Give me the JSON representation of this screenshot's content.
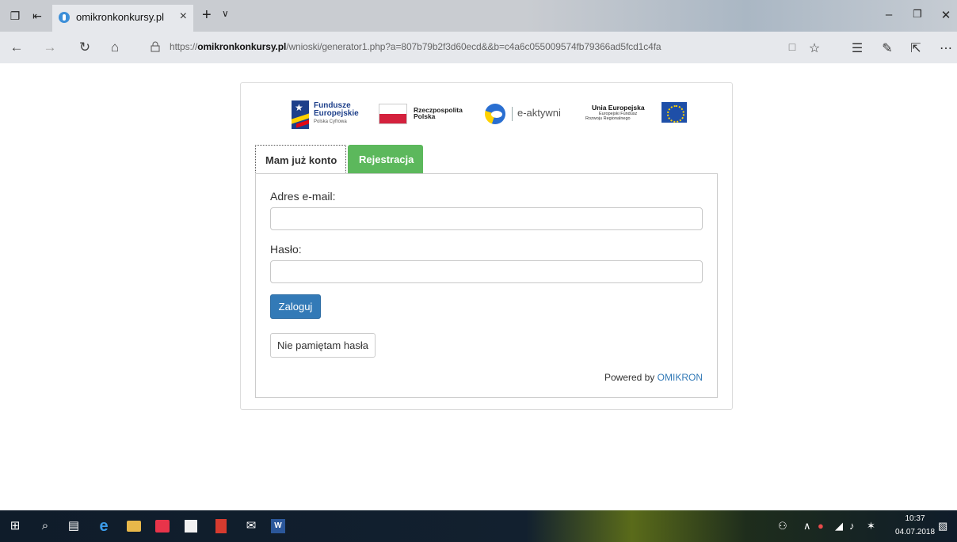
{
  "browser": {
    "tab_title": "omikronkonkursy.pl",
    "tab_close": "×",
    "new_tab": "+",
    "tab_menu": "∨",
    "url_prefix": "https://",
    "url_host": "omikronkonkursy.pl",
    "url_path": "/wnioski/generator1.php?a=807b79b2f3d60ecd&&b=c4a6c055009574fb79366ad5fcd1c4fa"
  },
  "logos": {
    "fe_line1": "Fundusze",
    "fe_line2": "Europejskie",
    "fe_line3": "Polska Cyfrowa",
    "pl_line1": "Rzeczpospolita",
    "pl_line2": "Polska",
    "ea_text": "e-aktywni",
    "ue_line1": "Unia Europejska",
    "ue_line2": "Europejski Fundusz",
    "ue_line3": "Rozwoju Regionalnego"
  },
  "tabs": {
    "login": "Mam już konto",
    "register": "Rejestracja"
  },
  "form": {
    "email_label": "Adres e-mail:",
    "email_value": "",
    "password_label": "Hasło:",
    "password_value": "",
    "submit_label": "Zaloguj",
    "forgot_label": "Nie pamiętam hasła"
  },
  "footer": {
    "powered_by": "Powered by",
    "brand": "OMIKRON"
  },
  "taskbar": {
    "time": "10:37",
    "date": "04.07.2018",
    "word_icon": "W"
  },
  "colors": {
    "register_tab": "#5cb85c",
    "primary_button": "#337ab7",
    "link": "#337ab7"
  }
}
